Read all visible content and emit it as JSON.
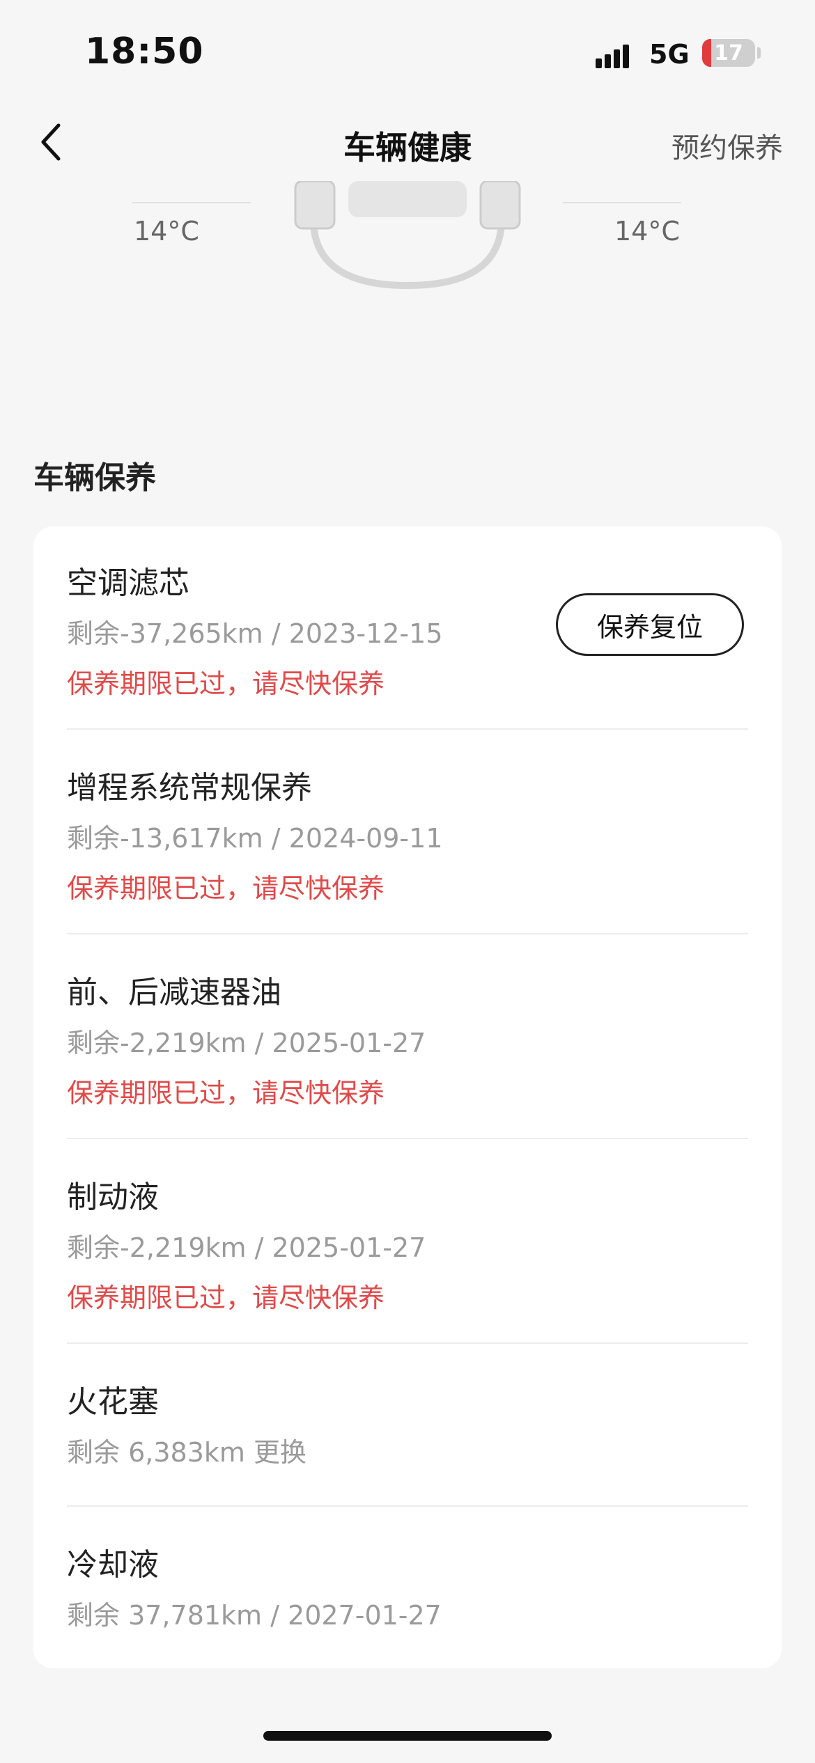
{
  "status_bar": {
    "time": "18:50",
    "network": "5G",
    "battery": "17",
    "battery_level": 0.17
  },
  "nav": {
    "title": "车辆健康",
    "action": "预约保养",
    "back_icon": "chevron-left-icon"
  },
  "diagram": {
    "left_temp": "14°C",
    "right_temp": "14°C"
  },
  "section": {
    "title": "车辆保养"
  },
  "colors": {
    "warning": "#e04a4a",
    "secondary_text": "#9a9a9a",
    "background": "#f6f6f6"
  },
  "items": [
    {
      "name": "空调滤芯",
      "detail": "剩余-37,265km / 2023-12-15",
      "warn": "保养期限已过，请尽快保养",
      "button": "保养复位"
    },
    {
      "name": "增程系统常规保养",
      "detail": "剩余-13,617km / 2024-09-11",
      "warn": "保养期限已过，请尽快保养"
    },
    {
      "name": "前、后减速器油",
      "detail": "剩余-2,219km / 2025-01-27",
      "warn": "保养期限已过，请尽快保养"
    },
    {
      "name": "制动液",
      "detail": "剩余-2,219km / 2025-01-27",
      "warn": "保养期限已过，请尽快保养"
    },
    {
      "name": "火花塞",
      "detail": "剩余 6,383km 更换"
    },
    {
      "name": "冷却液",
      "detail": "剩余 37,781km / 2027-01-27"
    }
  ]
}
